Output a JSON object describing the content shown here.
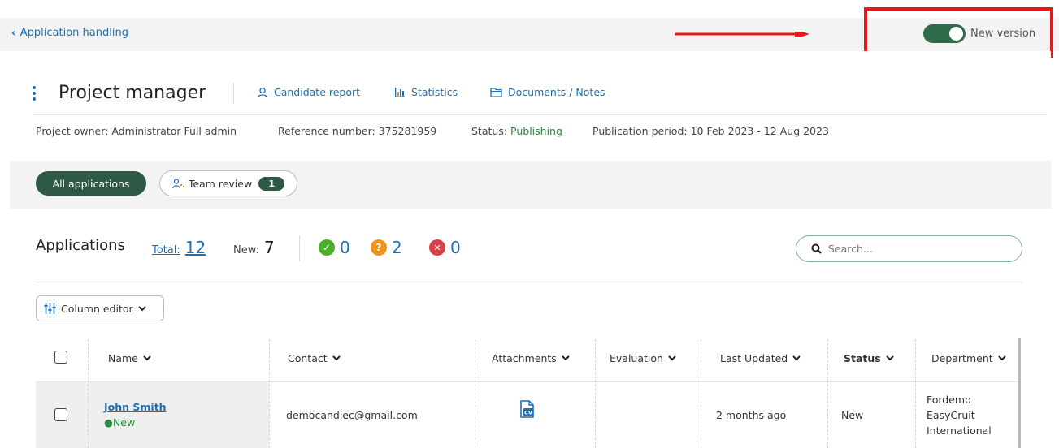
{
  "topbar": {
    "back_label": "Application handling",
    "toggle_label": "New version",
    "toggle_on": true
  },
  "header": {
    "title": "Project manager",
    "links": {
      "candidate_report": "Candidate report",
      "statistics": "Statistics",
      "documents": "Documents / Notes"
    },
    "meta": {
      "owner_label": "Project owner:",
      "owner_value": "Administrator Full admin",
      "ref_label": "Reference number:",
      "ref_value": "375281959",
      "status_label": "Status:",
      "status_value": "Publishing",
      "period_label": "Publication period:",
      "period_value": "10 Feb 2023 - 12 Aug 2023"
    }
  },
  "filters": {
    "all_label": "All applications",
    "team_label": "Team review",
    "team_count": "1"
  },
  "summary": {
    "title": "Applications",
    "total_label": "Total:",
    "total_value": "12",
    "new_label": "New:",
    "new_value": "7",
    "approved": "0",
    "pending": "2",
    "rejected": "0"
  },
  "search": {
    "placeholder": "Search..."
  },
  "column_editor_label": "Column editor",
  "table": {
    "headers": {
      "name": "Name",
      "contact": "Contact",
      "attachments": "Attachments",
      "evaluation": "Evaluation",
      "last_updated": "Last Updated",
      "status": "Status",
      "department": "Department"
    },
    "rows": [
      {
        "name": "John Smith",
        "tag": "New",
        "contact": "democandiec@gmail.com",
        "attachment_icon": "cv-document-icon",
        "last_updated": "2 months ago",
        "status": "New",
        "department_lines": [
          "Fordemo",
          "EasyCruit",
          "International"
        ]
      }
    ]
  },
  "colors": {
    "link": "#1f6fb5",
    "toggle": "#2e6b4b",
    "highlight": "#e31919",
    "approved": "#4caf2a",
    "pending": "#f0931d",
    "rejected": "#d9414a"
  }
}
